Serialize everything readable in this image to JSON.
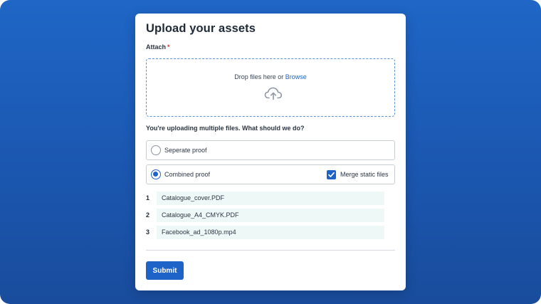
{
  "form": {
    "title": "Upload your assets",
    "attach_label": "Attach",
    "required_mark": "*",
    "dropzone": {
      "text": "Drop files here or",
      "browse_link": "Browse",
      "icon": "cloud-upload-icon"
    },
    "question": "You're uploading multiple files. What should we do?",
    "options": [
      {
        "label": "Seperate proof",
        "selected": false
      },
      {
        "label": "Combined proof",
        "selected": true
      }
    ],
    "merge_static": {
      "label": "Merge static files",
      "checked": true
    },
    "files": [
      {
        "num": "1",
        "name": "Catalogue_cover.PDF"
      },
      {
        "num": "2",
        "name": "Catalogue_A4_CMYK.PDF"
      },
      {
        "num": "3",
        "name": "Facebook_ad_1080p.mp4"
      }
    ],
    "submit_label": "Submit"
  },
  "colors": {
    "accent": "#1e64c8",
    "background": "#1b57b0",
    "file_row_bg": "#eef8f6",
    "required": "#d9362b"
  }
}
